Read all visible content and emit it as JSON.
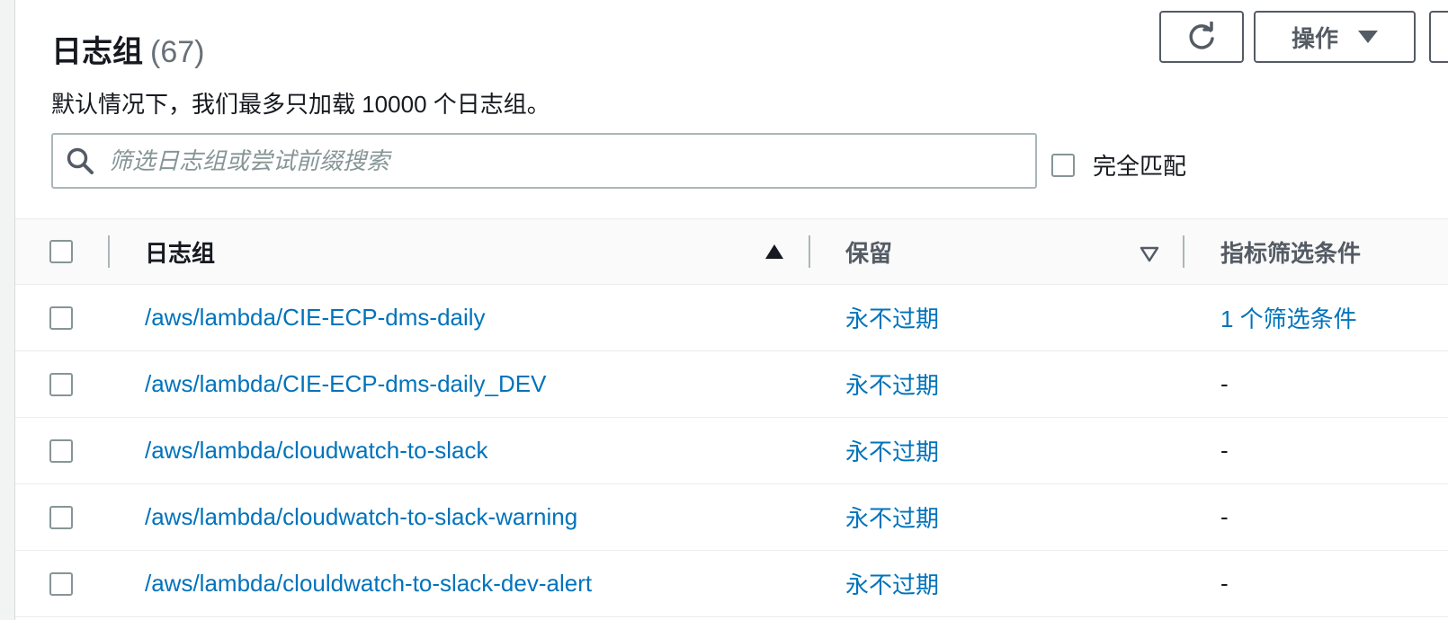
{
  "header": {
    "title": "日志组",
    "count": "(67)",
    "description": "默认情况下，我们最多只加载 10000 个日志组。"
  },
  "toolbar": {
    "refresh_icon": "refresh-icon",
    "actions_label": "操作"
  },
  "search": {
    "placeholder": "筛选日志组或尝试前缀搜索",
    "value": ""
  },
  "exact_match": {
    "label": "完全匹配",
    "checked": false
  },
  "table": {
    "columns": [
      {
        "label": "日志组",
        "sort": "ascending"
      },
      {
        "label": "保留",
        "sort": "descending-inactive"
      },
      {
        "label": "指标筛选条件",
        "sort": "none"
      }
    ],
    "rows": [
      {
        "log_group": "/aws/lambda/CIE-ECP-dms-daily",
        "retention": "永不过期",
        "metric_filters": "1 个筛选条件"
      },
      {
        "log_group": "/aws/lambda/CIE-ECP-dms-daily_DEV",
        "retention": "永不过期",
        "metric_filters": "-"
      },
      {
        "log_group": "/aws/lambda/cloudwatch-to-slack",
        "retention": "永不过期",
        "metric_filters": "-"
      },
      {
        "log_group": "/aws/lambda/cloudwatch-to-slack-warning",
        "retention": "永不过期",
        "metric_filters": "-"
      },
      {
        "log_group": "/aws/lambda/clouldwatch-to-slack-dev-alert",
        "retention": "永不过期",
        "metric_filters": "-"
      }
    ]
  },
  "colors": {
    "link": "#0073bb",
    "border": "#545b64"
  }
}
